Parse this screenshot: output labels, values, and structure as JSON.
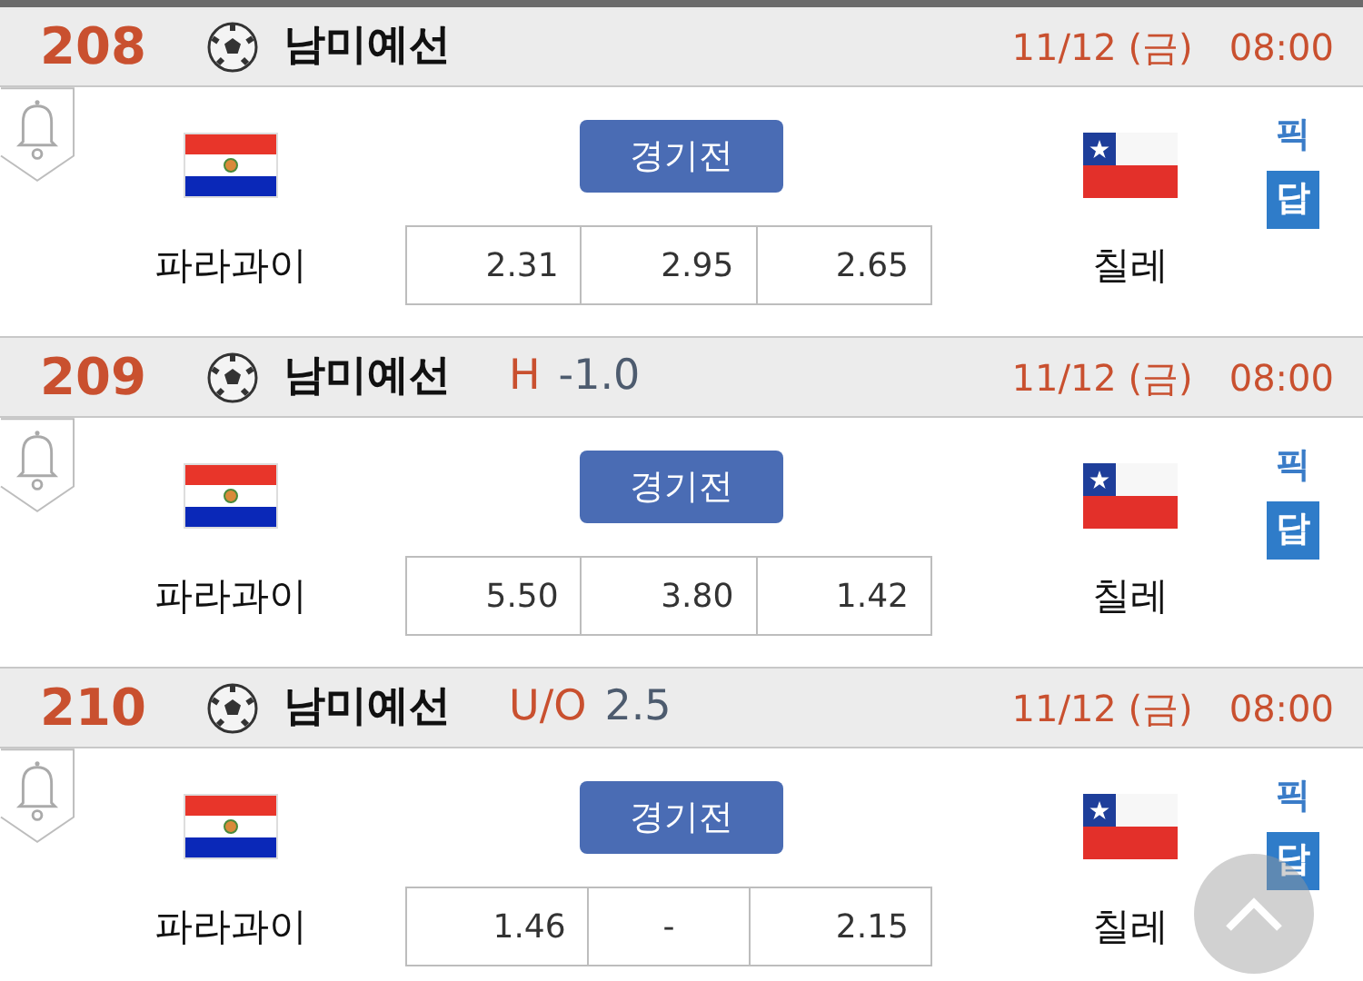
{
  "matches": [
    {
      "number": "208",
      "league": "남미예선",
      "date": "11/12 (금)",
      "time": "08:00",
      "status": "경기전",
      "home": "파라과이",
      "away": "칠레",
      "odds": [
        "2.31",
        "2.95",
        "2.65"
      ],
      "pick": "픽",
      "answer": "답"
    },
    {
      "number": "209",
      "league": "남미예선",
      "handicap": {
        "label": "H",
        "value": "-1.0"
      },
      "date": "11/12 (금)",
      "time": "08:00",
      "status": "경기전",
      "home": "파라과이",
      "away": "칠레",
      "odds": [
        "5.50",
        "3.80",
        "1.42"
      ],
      "pick": "픽",
      "answer": "답"
    },
    {
      "number": "210",
      "league": "남미예선",
      "handicap": {
        "label": "U/O",
        "value": "2.5"
      },
      "date": "11/12 (금)",
      "time": "08:00",
      "status": "경기전",
      "home": "파라과이",
      "away": "칠레",
      "odds": [
        "1.46",
        "-",
        "2.15"
      ],
      "pick": "픽",
      "answer": "답"
    }
  ]
}
